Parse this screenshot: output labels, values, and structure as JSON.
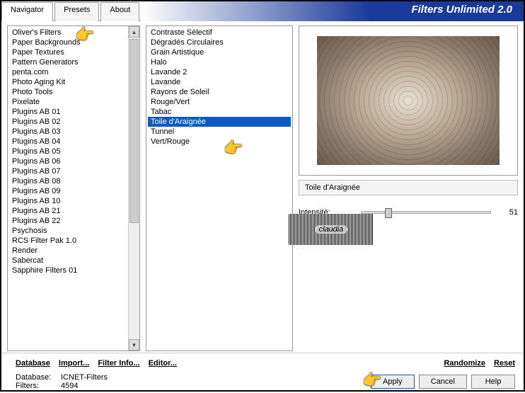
{
  "title": "Filters Unlimited 2.0",
  "tabs": [
    {
      "label": "Navigator",
      "active": true
    },
    {
      "label": "Presets",
      "active": false
    },
    {
      "label": "About",
      "active": false
    }
  ],
  "categories": [
    "Oliver's Filters",
    "Paper Backgrounds",
    "Paper Textures",
    "Pattern Generators",
    "penta.com",
    "Photo Aging Kit",
    "Photo Tools",
    "Pixelate",
    "Plugins AB 01",
    "Plugins AB 02",
    "Plugins AB 03",
    "Plugins AB 04",
    "Plugins AB 05",
    "Plugins AB 06",
    "Plugins AB 07",
    "Plugins AB 08",
    "Plugins AB 09",
    "Plugins AB 10",
    "Plugins AB 21",
    "Plugins AB 22",
    "Psychosis",
    "RCS Filter Pak 1.0",
    "Render",
    "Sabercat",
    "Sapphire Filters 01"
  ],
  "filters": [
    "Contraste Sélectif",
    "Dégradés Circulaires",
    "Grain Artistique",
    "Halo",
    "Lavande 2",
    "Lavande",
    "Rayons de Soleil",
    "Rouge/Vert",
    "Tabac",
    "Toile d'Araignée",
    "Tunnel",
    "Vert/Rouge"
  ],
  "selected_filter_index": 9,
  "current_filter_name": "Toile d'Araignée",
  "param": {
    "label": "Intensité:",
    "value": "51"
  },
  "bottom_buttons": {
    "database": "Database",
    "import": "Import...",
    "filter_info": "Filter Info...",
    "editor": "Editor...",
    "randomize": "Randomize",
    "reset": "Reset"
  },
  "status": {
    "db_label": "Database:",
    "db_value": "ICNET-Filters",
    "filters_label": "Filters:",
    "filters_value": "4594"
  },
  "action_buttons": {
    "apply": "Apply",
    "cancel": "Cancel",
    "help": "Help"
  },
  "watermark": "claudia"
}
